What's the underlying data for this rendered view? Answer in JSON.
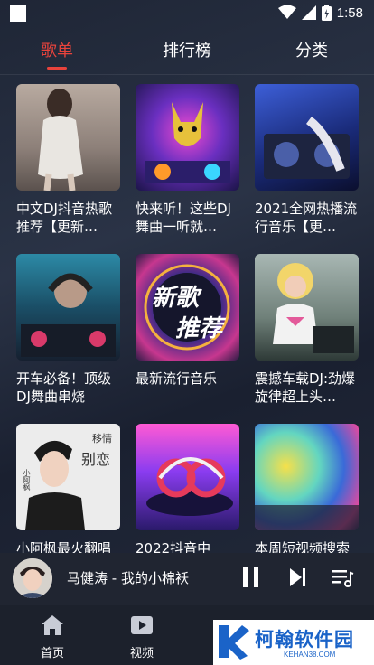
{
  "status": {
    "time": "1:58"
  },
  "tabs": [
    {
      "label": "歌单"
    },
    {
      "label": "排行榜"
    },
    {
      "label": "分类"
    }
  ],
  "playlists": [
    {
      "title": "中文DJ抖音热歌推荐【更新…",
      "cover": "girl-in-white-dress"
    },
    {
      "title": "快来听！这些DJ舞曲一听就…",
      "cover": "neon-dog-dj"
    },
    {
      "title": "2021全网热播流行音乐【更…",
      "cover": "dj-mixer-blue"
    },
    {
      "title": "开车必备！顶级DJ舞曲串烧",
      "cover": "dj-with-headphones"
    },
    {
      "title": "最新流行音乐",
      "cover": "new-songs-recommend",
      "cover_text_1": "新歌",
      "cover_text_2": "推荐"
    },
    {
      "title": "震撼车载DJ:劲爆旋律超上头…",
      "cover": "blonde-girl-dj"
    },
    {
      "title": "小阿枫最火翻唱",
      "cover": "singer-portrait",
      "cover_text_1": "别恋",
      "cover_text_2": "移情",
      "cover_text_3": "小阿枫"
    },
    {
      "title": "2022抖音中",
      "cover": "headphones-vinyl"
    },
    {
      "title": "本周短视频搜索",
      "cover": "color-powder-crowd"
    }
  ],
  "player": {
    "song": "马健涛 - 我的小棉袄"
  },
  "nav": [
    {
      "label": "首页",
      "icon": "home-icon"
    },
    {
      "label": "视频",
      "icon": "video-icon"
    }
  ],
  "watermark": {
    "name": "柯翰软件园",
    "url": "KEHAN38.COM"
  },
  "colors": {
    "accent": "#e8433c",
    "background": "#232a3a"
  }
}
